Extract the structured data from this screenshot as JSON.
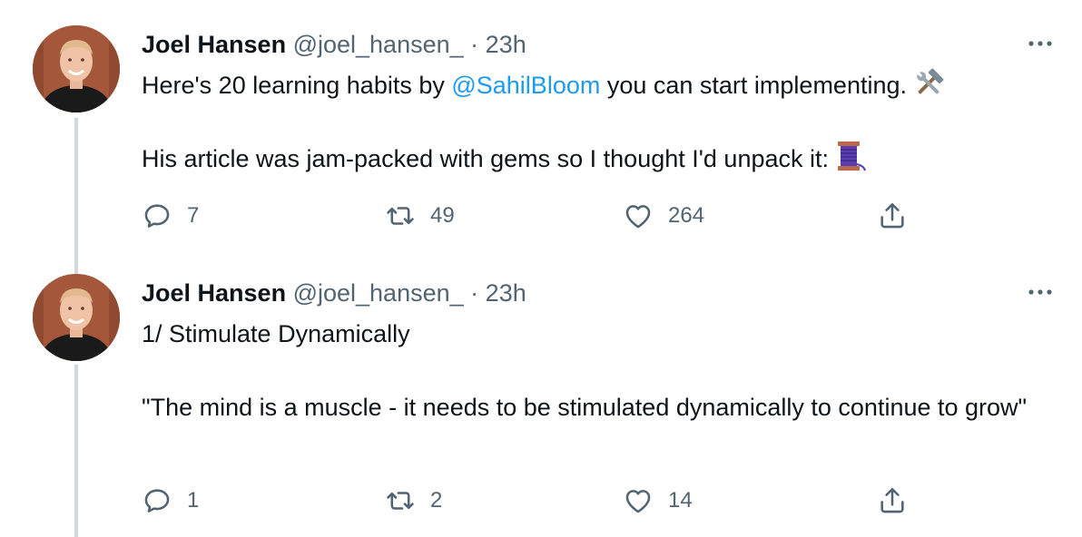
{
  "tweets": [
    {
      "author_name": "Joel Hansen",
      "handle": "@joel_hansen_",
      "separator": "·",
      "time": "23h",
      "text_before_mention": "Here's 20 learning habits by ",
      "mention": "@SahilBloom",
      "text_after_mention": " you can start implementing.",
      "second_paragraph": "His article was jam-packed with gems so I thought I'd unpack it:",
      "emoji_line1": "hammer-and-wrench-icon",
      "emoji_line2": "thread-spool-icon",
      "replies": "7",
      "retweets": "49",
      "likes": "264"
    },
    {
      "author_name": "Joel Hansen",
      "handle": "@joel_hansen_",
      "separator": "·",
      "time": "23h",
      "first_paragraph": "1/ Stimulate Dynamically",
      "second_paragraph": "\"The mind is a muscle - it needs to be stimulated dynamically to continue to grow\"",
      "replies": "1",
      "retweets": "2",
      "likes": "14"
    }
  ],
  "colors": {
    "text": "#0f1419",
    "secondary": "#536471",
    "link": "#1d9bf0",
    "thread_line": "#cfd9de"
  }
}
